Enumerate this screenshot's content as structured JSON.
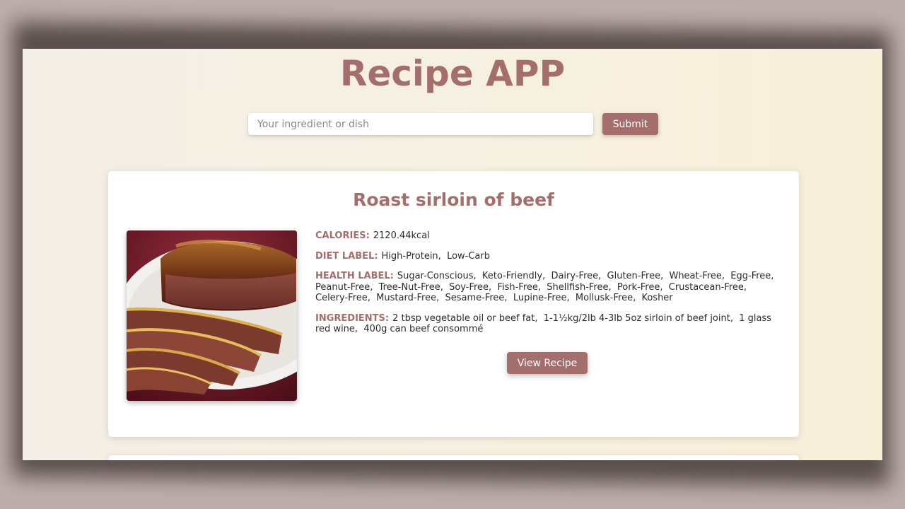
{
  "app": {
    "title": "Recipe APP"
  },
  "search": {
    "placeholder": "Your ingredient or dish",
    "value": "",
    "submit_label": "Submit"
  },
  "recipe": {
    "title": "Roast sirloin of beef",
    "image_alt": "Roast sirloin of beef",
    "calories_label": "CALORIES:",
    "calories_value": "2120.44kcal",
    "diet_label": "DIET LABEL:",
    "diet_value": "High-Protein,  Low-Carb",
    "health_label": "HEALTH LABEL:",
    "health_value": "Sugar-Conscious,  Keto-Friendly,  Dairy-Free,  Gluten-Free,  Wheat-Free,  Egg-Free,  Peanut-Free,  Tree-Nut-Free,  Soy-Free,  Fish-Free,  Shellfish-Free,  Pork-Free,  Crustacean-Free,  Celery-Free,  Mustard-Free,  Sesame-Free,  Lupine-Free,  Mollusk-Free,  Kosher",
    "ingredients_label": "INGREDIENTS:",
    "ingredients_value": "2 tbsp vegetable oil or beef fat,  1-1½kg/2lb 4-3lb 5oz sirloin of beef joint,  1 glass red wine,  400g can beef consommé",
    "view_label": "View Recipe"
  },
  "colors": {
    "accent": "#a46e6c",
    "backdrop": "#bcadab",
    "page_bg": "#f5f0e4",
    "card_bg": "#ffffff"
  }
}
